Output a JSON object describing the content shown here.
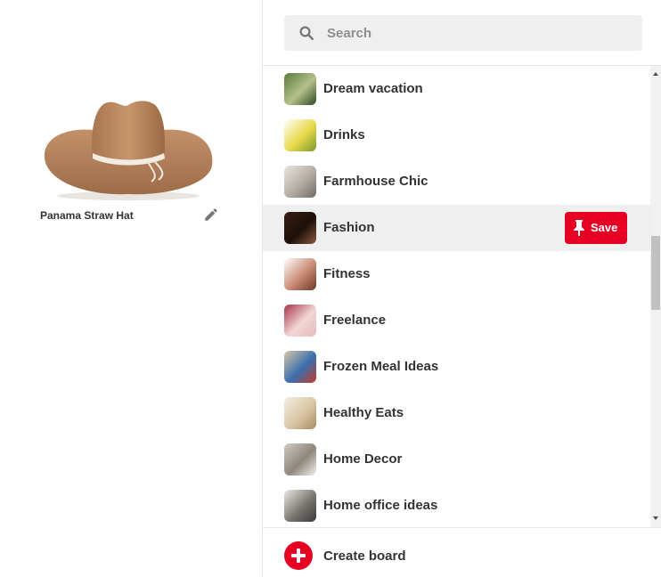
{
  "pin": {
    "title": "Panama Straw Hat",
    "image_icon": "straw-hat-image",
    "edit_icon": "pencil-icon"
  },
  "search": {
    "placeholder": "Search",
    "value": "",
    "icon": "search-icon"
  },
  "boards": [
    {
      "name": "Dream vacation",
      "thumb": "garden-thumbnail",
      "thumb_colors": [
        "#5a7a3a",
        "#b4c08a",
        "#2d4a20"
      ]
    },
    {
      "name": "Drinks",
      "thumb": "lemon-drinks-thumbnail",
      "thumb_colors": [
        "#ffffff",
        "#e8d94a",
        "#7a9a2a"
      ]
    },
    {
      "name": "Farmhouse Chic",
      "thumb": "farmhouse-room-thumbnail",
      "thumb_colors": [
        "#e9e6e1",
        "#b3aca4",
        "#6f6a64"
      ]
    },
    {
      "name": "Fashion",
      "thumb": "fashion-thumbnail",
      "thumb_colors": [
        "#3a1e12",
        "#1c0f0a",
        "#8c5a3e"
      ],
      "highlighted": true
    },
    {
      "name": "Fitness",
      "thumb": "fitness-text-thumbnail",
      "thumb_colors": [
        "#ffffff",
        "#c98a73",
        "#6a3a2a"
      ]
    },
    {
      "name": "Freelance",
      "thumb": "freelance-thumbnail",
      "thumb_colors": [
        "#a8324a",
        "#f0d6d6",
        "#e7b9b9"
      ]
    },
    {
      "name": "Frozen Meal Ideas",
      "thumb": "frozen-meals-thumbnail",
      "thumb_colors": [
        "#d7c6a4",
        "#3a6fae",
        "#c23b2a"
      ]
    },
    {
      "name": "Healthy Eats",
      "thumb": "healthy-eats-thumbnail",
      "thumb_colors": [
        "#f2efe6",
        "#d9c6a3",
        "#a78c5f"
      ]
    },
    {
      "name": "Home Decor",
      "thumb": "home-decor-thumbnail",
      "thumb_colors": [
        "#cfcac2",
        "#8e877c",
        "#f3f1ee"
      ]
    },
    {
      "name": "Home office ideas",
      "thumb": "home-office-thumbnail",
      "thumb_colors": [
        "#ebe9e6",
        "#7b7670",
        "#3a3a3a"
      ]
    }
  ],
  "save_button": {
    "label": "Save",
    "icon": "pushpin-icon",
    "color": "#e60023"
  },
  "create_board": {
    "label": "Create board",
    "icon": "plus-circle-icon",
    "color": "#e60023"
  },
  "scrollbar": {
    "thumb_start_fraction": 0.36,
    "thumb_size_fraction": 0.17
  }
}
